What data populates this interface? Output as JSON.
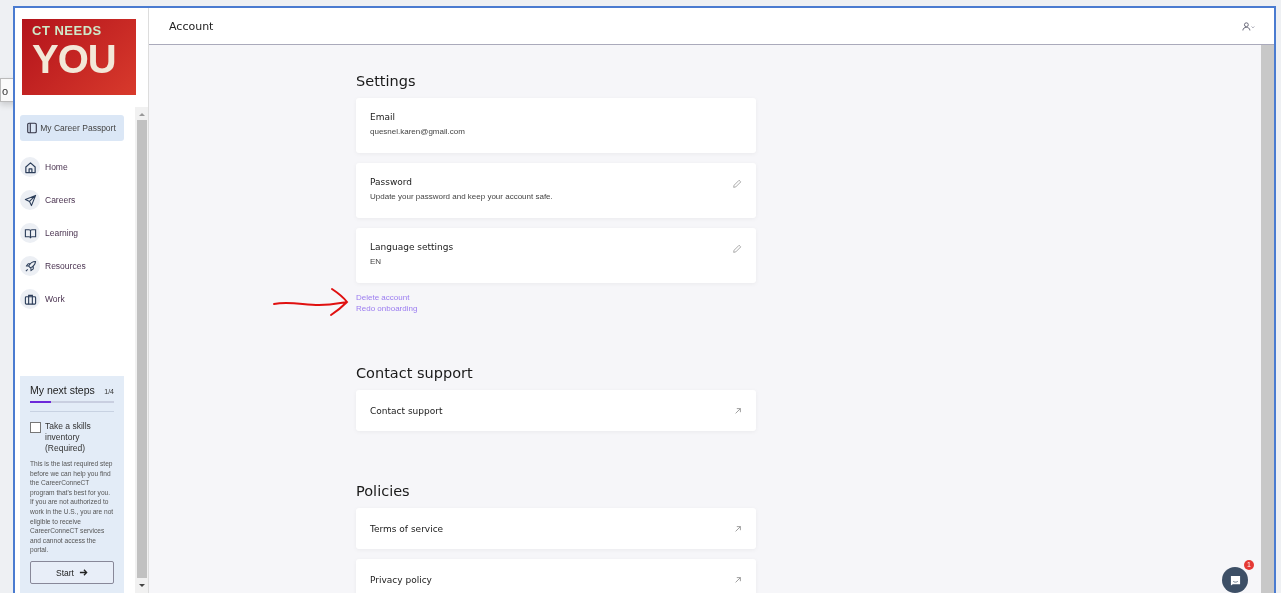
{
  "background_window": {
    "text": "o"
  },
  "header": {
    "title": "Account"
  },
  "sidebar": {
    "logo": {
      "line_1": "CT NEEDS",
      "line_2": "YOU"
    },
    "passport": {
      "label": "My Career Passport",
      "selected": true
    },
    "items": [
      {
        "label": "Home"
      },
      {
        "label": "Careers"
      },
      {
        "label": "Learning"
      },
      {
        "label": "Resources"
      },
      {
        "label": "Work"
      }
    ],
    "next_steps": {
      "title": "My next steps",
      "count": "1/4",
      "level": 0.25,
      "task": {
        "label": "Take a skills inventory (Required)",
        "checked": false
      },
      "description": "This is the last required step before we can help you find the CareerConneCT program that's best for you. If you are not authorized to work in the U.S., you are not eligible to receive CareerConneCT services and cannot access the portal.",
      "button": "Start"
    }
  },
  "sections": [
    {
      "title": "Settings",
      "cards": [
        {
          "kind": "info",
          "label": "Email",
          "value": "quesnel.karen@gmail.com"
        },
        {
          "kind": "editable",
          "label": "Password",
          "value": "Update your password and keep your account safe."
        },
        {
          "kind": "editable",
          "label": "Language settings",
          "value": "EN"
        }
      ],
      "links": [
        "Delete account",
        "Redo onboarding"
      ]
    },
    {
      "title": "Contact support",
      "cards": [
        {
          "kind": "external",
          "label": "Contact support"
        }
      ]
    },
    {
      "title": "Policies",
      "cards": [
        {
          "kind": "external",
          "label": "Terms of service"
        },
        {
          "kind": "external",
          "label": "Privacy policy"
        }
      ]
    }
  ],
  "chat": {
    "badge": "1"
  }
}
